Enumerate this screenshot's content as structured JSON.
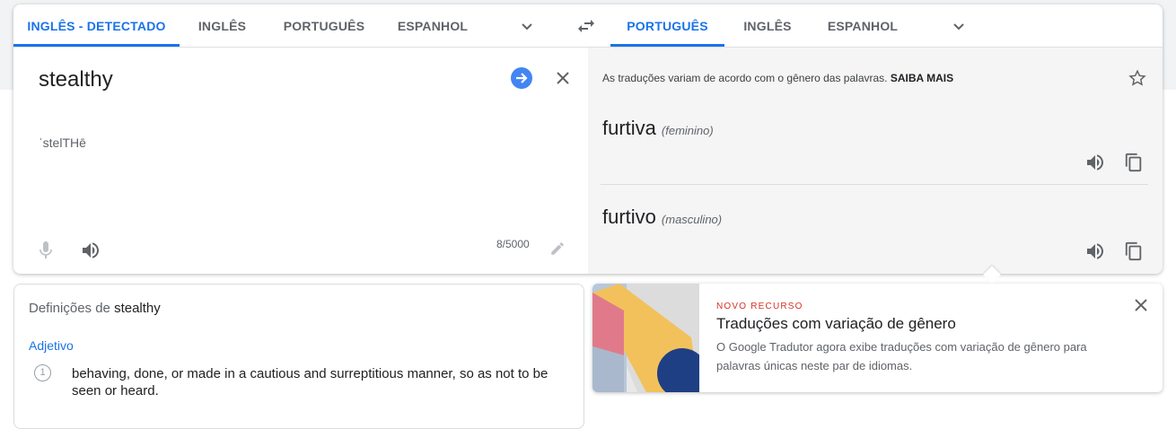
{
  "source_langs": {
    "detected": "INGLÊS - DETECTADO",
    "tab1": "INGLÊS",
    "tab2": "PORTUGUÊS",
    "tab3": "ESPANHOL"
  },
  "target_langs": {
    "active": "PORTUGUÊS",
    "tab1": "INGLÊS",
    "tab2": "ESPANHOL"
  },
  "source": {
    "text": "stealthy",
    "transliteration": "ˈstelTHē",
    "char_count": "8/5000"
  },
  "target": {
    "gender_note": "As traduções variam de acordo com o gênero das palavras.",
    "learn_more": "SAIBA MAIS",
    "translations": [
      {
        "word": "furtiva",
        "gender": "(feminino)"
      },
      {
        "word": "furtivo",
        "gender": "(masculino)"
      }
    ]
  },
  "definitions": {
    "title_prefix": "Definições de",
    "term": "stealthy",
    "part_of_speech": "Adjetivo",
    "items": [
      {
        "number": "1",
        "text": "behaving, done, or made in a cautious and surreptitious manner, so as not to be seen or heard."
      }
    ]
  },
  "feature": {
    "badge": "NOVO RECURSO",
    "title": "Traduções com variação de gênero",
    "description": "O Google Tradutor agora exibe traduções com variação de gênero para palavras únicas neste par de idiomas."
  },
  "colors": {
    "accent": "#1a73e8",
    "badge": "#d93025",
    "target_bg": "#f5f5f5"
  }
}
